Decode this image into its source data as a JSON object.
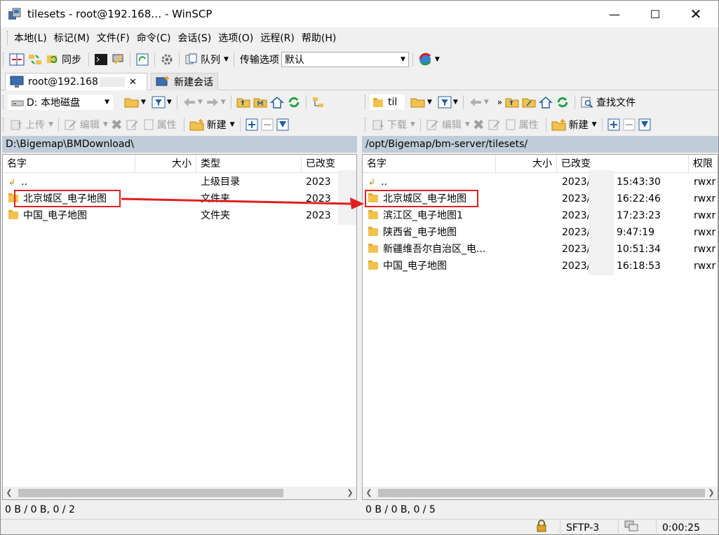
{
  "window": {
    "title": "tilesets - root@192.168… - WinSCP"
  },
  "menu": [
    "本地(L)",
    "标记(M)",
    "文件(F)",
    "命令(C)",
    "会话(S)",
    "选项(O)",
    "远程(R)",
    "帮助(H)"
  ],
  "toolbar": {
    "sync": "同步",
    "queue": "队列",
    "transfer_options": "传输选项",
    "transfer_default": "默认"
  },
  "tabs": {
    "session": "root@192.168",
    "new_session": "新建会话"
  },
  "local": {
    "drive": "D: 本地磁盘",
    "upload": "上传",
    "edit": "编辑",
    "properties": "属性",
    "new": "新建",
    "path": "D:\\Bigemap\\BMDownload\\",
    "columns": {
      "name": "名字",
      "size": "大小",
      "type": "类型",
      "changed": "已改变"
    },
    "rows": [
      {
        "name": "..",
        "type": "上级目录",
        "changed": "2023"
      },
      {
        "name": "北京城区_电子地图",
        "type": "文件夹",
        "changed": "2023"
      },
      {
        "name": "中国_电子地图",
        "type": "文件夹",
        "changed": "2023"
      }
    ],
    "status": "0 B / 0 B,  0 / 2"
  },
  "remote": {
    "dir": "til",
    "download": "下载",
    "edit": "编辑",
    "properties": "属性",
    "new": "新建",
    "find_files": "查找文件",
    "path": "/opt/Bigemap/bm-server/tilesets/",
    "columns": {
      "name": "名字",
      "size": "大小",
      "changed": "已改变",
      "rights": "权限"
    },
    "rows": [
      {
        "name": "..",
        "date": "2023/",
        "time": "15:43:30",
        "rights": "rwxr"
      },
      {
        "name": "北京城区_电子地图",
        "date": "2023/",
        "time": "16:22:46",
        "rights": "rwxr"
      },
      {
        "name": "滨江区_电子地图1",
        "date": "2023/",
        "time": "17:23:23",
        "rights": "rwxr"
      },
      {
        "name": "陕西省_电子地图",
        "date": "2023/",
        "time": "9:47:19",
        "rights": "rwxr"
      },
      {
        "name": "新疆维吾尔自治区_电...",
        "date": "2023/",
        "time": "10:51:34",
        "rights": "rwxr"
      },
      {
        "name": "中国_电子地图",
        "date": "2023/",
        "time": "16:18:53",
        "rights": "rwxr"
      }
    ],
    "status": "0 B / 0 B,  0 / 5"
  },
  "statusbar": {
    "protocol": "SFTP-3",
    "elapsed": "0:00:25"
  },
  "colors": {
    "path_bar": "#bfcddb",
    "highlight": "#e02020",
    "folder": "#f2c14e"
  }
}
